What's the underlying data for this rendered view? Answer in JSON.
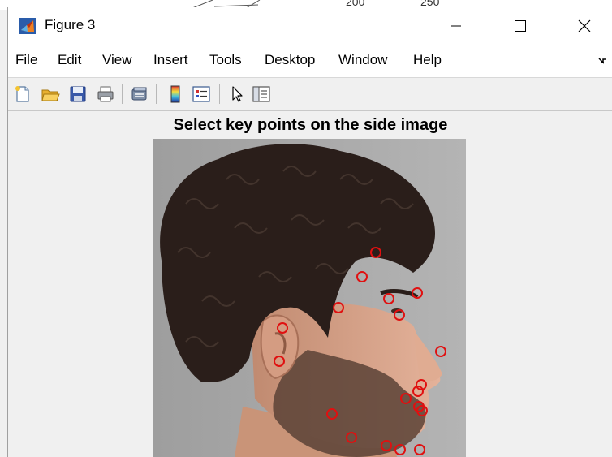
{
  "background_window": {
    "axis_labels": [
      "200",
      "250"
    ]
  },
  "window": {
    "title": "Figure 3",
    "controls": [
      "minimize",
      "maximize",
      "close"
    ]
  },
  "menubar": {
    "items": [
      "File",
      "Edit",
      "View",
      "Insert",
      "Tools",
      "Desktop",
      "Window",
      "Help"
    ]
  },
  "toolbar": {
    "buttons": [
      {
        "name": "new-figure-icon"
      },
      {
        "name": "open-file-icon"
      },
      {
        "name": "save-icon"
      },
      {
        "name": "print-icon"
      },
      {
        "name": "link-plot-icon"
      },
      {
        "name": "colorbar-icon"
      },
      {
        "name": "legend-icon"
      },
      {
        "name": "edit-plot-icon"
      },
      {
        "name": "property-inspector-icon"
      }
    ]
  },
  "figure": {
    "title": "Select key points on the side image",
    "marker_color": "#e01010",
    "image_description": "side-profile photograph of a man with curly dark hair and beard",
    "key_point_count": 23
  },
  "colors": {
    "window_bg": "#f0f0f0",
    "titlebar_bg": "#ffffff",
    "marker": "#e01010"
  }
}
